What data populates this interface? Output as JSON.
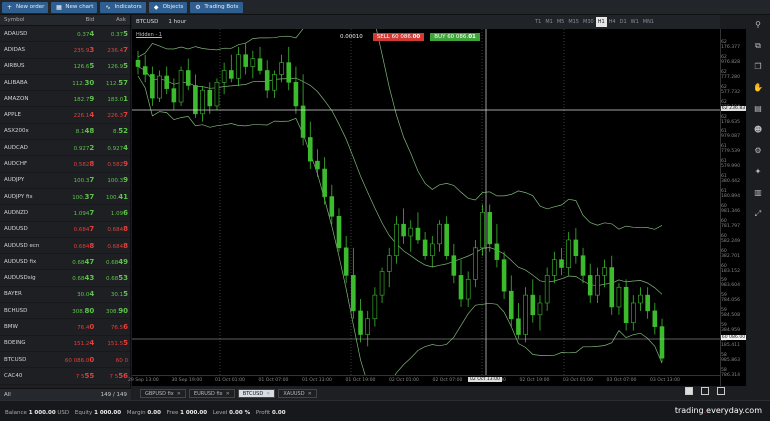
{
  "toolbar": {
    "buttons": [
      {
        "label": "New order",
        "icon": "plus-icon"
      },
      {
        "label": "New chart",
        "icon": "chart-icon"
      },
      {
        "label": "Indicators",
        "icon": "indicators-icon"
      },
      {
        "label": "Objects",
        "icon": "objects-icon"
      },
      {
        "label": "Trading Bots",
        "icon": "bot-icon"
      }
    ]
  },
  "watchlist": {
    "headers": {
      "symbol": "Symbol",
      "bid": "Bid",
      "ask": "Ask"
    },
    "rows": [
      {
        "symbol": "ADAUSD",
        "bid": "0.37",
        "bid_big": "4",
        "ask": "0.37",
        "ask_big": "5",
        "dir": "up"
      },
      {
        "symbol": "ADIDAS",
        "bid": "235.9",
        "bid_big": "3",
        "ask": "236.4",
        "ask_big": "7",
        "dir": "down"
      },
      {
        "symbol": "AIRBUS",
        "bid": "126.6",
        "bid_big": "5",
        "ask": "126.9",
        "ask_big": "5",
        "dir": "up"
      },
      {
        "symbol": "ALIBABA",
        "bid": "112.",
        "bid_big": "30",
        "ask": "112.",
        "ask_big": "57",
        "dir": "up"
      },
      {
        "symbol": "AMAZON",
        "bid": "182.7",
        "bid_big": "9",
        "ask": "183.0",
        "ask_big": "1",
        "dir": "up"
      },
      {
        "symbol": "APPLE",
        "bid": "226.1",
        "bid_big": "4",
        "ask": "226.3",
        "ask_big": "7",
        "dir": "down"
      },
      {
        "symbol": "ASX200x",
        "bid": "8.1",
        "bid_big": "48",
        "ask": "8.",
        "ask_big": "52",
        "dir": "up"
      },
      {
        "symbol": "AUDCAD",
        "bid": "0.927",
        "bid_big": "2",
        "ask": "0.927",
        "ask_big": "4",
        "dir": "up"
      },
      {
        "symbol": "AUDCHF",
        "bid": "0.582",
        "bid_big": "8",
        "ask": "0.582",
        "ask_big": "9",
        "dir": "down"
      },
      {
        "symbol": "AUDJPY",
        "bid": "100.3",
        "bid_big": "7",
        "ask": "100.3",
        "ask_big": "9",
        "dir": "up"
      },
      {
        "symbol": "AUDJPY fix",
        "bid": "100.",
        "bid_big": "37",
        "ask": "100.",
        "ask_big": "41",
        "dir": "up"
      },
      {
        "symbol": "AUDNZD",
        "bid": "1.094",
        "bid_big": "7",
        "ask": "1.09",
        "ask_big": "6",
        "dir": "up"
      },
      {
        "symbol": "AUDUSD",
        "bid": "0.684",
        "bid_big": "7",
        "ask": "0.684",
        "ask_big": "8",
        "dir": "down"
      },
      {
        "symbol": "AUDUSD ecn",
        "bid": "0.684",
        "bid_big": "8",
        "ask": "0.684",
        "ask_big": "8",
        "dir": "down"
      },
      {
        "symbol": "AUDUSD fix",
        "bid": "0.68",
        "bid_big": "47",
        "ask": "0.68",
        "ask_big": "49",
        "dir": "up"
      },
      {
        "symbol": "AUDUSDsig",
        "bid": "0.68",
        "bid_big": "43",
        "ask": "0.68",
        "ask_big": "53",
        "dir": "up"
      },
      {
        "symbol": "BAYER",
        "bid": "30.0",
        "bid_big": "4",
        "ask": "30.1",
        "ask_big": "5",
        "dir": "up"
      },
      {
        "symbol": "BCHUSD",
        "bid": "308.",
        "bid_big": "80",
        "ask": "308.",
        "ask_big": "90",
        "dir": "up"
      },
      {
        "symbol": "BMW",
        "bid": "76.4",
        "bid_big": "0",
        "ask": "76.5",
        "ask_big": "6",
        "dir": "down"
      },
      {
        "symbol": "BOEING",
        "bid": "151.2",
        "bid_big": "4",
        "ask": "151.5",
        "ask_big": "5",
        "dir": "down"
      },
      {
        "symbol": "BTCUSD",
        "bid": "60 086.0",
        "bid_big": "0",
        "ask": "60 0",
        "ask_big": "",
        "dir": "down"
      },
      {
        "symbol": "CAC40",
        "bid": "7 5",
        "bid_big": "55",
        "ask": "7 5",
        "ask_big": "56",
        "dir": "down"
      }
    ],
    "footer": {
      "filter": "All",
      "count": "149 / 149"
    }
  },
  "chart": {
    "symbol": "BTCUSD",
    "timeframe": "1 hour",
    "timeframes": [
      "T1",
      "M1",
      "M5",
      "M15",
      "M30",
      "H1",
      "H4",
      "D1",
      "W1",
      "MN1"
    ],
    "active_timeframe": "H1",
    "indicator_label": "Hidden - 1",
    "trade": {
      "quantity": "0.00010",
      "sell_label": "SELL",
      "sell_price": "60 086.",
      "sell_big": "00",
      "buy_label": "BUY",
      "buy_price": "60 086.",
      "buy_big": "01"
    },
    "y_ticks": [
      "62 176.377",
      "62 976.828",
      "62 777.280",
      "62 577.732",
      "62 378.184",
      "62 178.635",
      "61 979.087",
      "61 779.539",
      "61 579.990",
      "61 380.442",
      "61 180.894",
      "60 981.346",
      "60 781.797",
      "60 582.249",
      "60 382.701",
      "60 183.152",
      "59 983.604",
      "59 784.056",
      "59 584.508",
      "59 384.959",
      "59 185.411",
      "58 985.863",
      "58 786.314"
    ],
    "crosshair_price": "62 236.83",
    "current_price": "60 086.00",
    "x_ticks": [
      "29 Sep 13:00",
      "30 Sep 19:00",
      "01 Oct 01:00",
      "01 Oct 07:00",
      "01 Oct 13:00",
      "01 Oct 19:00",
      "02 Oct 01:00",
      "02 Oct 07:00",
      "02 Oct 13:00",
      "02 Oct 19:00",
      "03 Oct 01:00",
      "03 Oct 07:00",
      "03 Oct 13:00"
    ],
    "crosshair_time": "02 Oct 13:00",
    "tabs": [
      {
        "label": "GBPUSD fix",
        "active": false
      },
      {
        "label": "EURUSD fix",
        "active": false
      },
      {
        "label": "BTCUSD",
        "active": true
      },
      {
        "label": "XAUUSD",
        "active": false
      }
    ]
  },
  "chart_data": {
    "type": "candlestick",
    "symbol": "BTCUSD",
    "timeframe": "H1",
    "ylim": [
      58786.314,
      63176.377
    ],
    "candle_color": "#3dbb2e",
    "candles": [
      {
        "o": 62780,
        "h": 62900,
        "l": 62600,
        "c": 62700
      },
      {
        "o": 62700,
        "h": 62850,
        "l": 62500,
        "c": 62600
      },
      {
        "o": 62600,
        "h": 62700,
        "l": 62200,
        "c": 62300
      },
      {
        "o": 62300,
        "h": 62650,
        "l": 62250,
        "c": 62580
      },
      {
        "o": 62580,
        "h": 62700,
        "l": 62350,
        "c": 62420
      },
      {
        "o": 62420,
        "h": 62550,
        "l": 62150,
        "c": 62250
      },
      {
        "o": 62250,
        "h": 62700,
        "l": 62200,
        "c": 62650
      },
      {
        "o": 62650,
        "h": 62800,
        "l": 62400,
        "c": 62460
      },
      {
        "o": 62460,
        "h": 62600,
        "l": 62050,
        "c": 62100
      },
      {
        "o": 62100,
        "h": 62450,
        "l": 62000,
        "c": 62400
      },
      {
        "o": 62400,
        "h": 62500,
        "l": 62100,
        "c": 62200
      },
      {
        "o": 62200,
        "h": 62550,
        "l": 62150,
        "c": 62500
      },
      {
        "o": 62500,
        "h": 62750,
        "l": 62350,
        "c": 62650
      },
      {
        "o": 62650,
        "h": 62850,
        "l": 62500,
        "c": 62550
      },
      {
        "o": 62550,
        "h": 62950,
        "l": 62450,
        "c": 62850
      },
      {
        "o": 62850,
        "h": 63000,
        "l": 62600,
        "c": 62700
      },
      {
        "o": 62700,
        "h": 62900,
        "l": 62550,
        "c": 62800
      },
      {
        "o": 62800,
        "h": 62950,
        "l": 62600,
        "c": 62650
      },
      {
        "o": 62650,
        "h": 62780,
        "l": 62300,
        "c": 62400
      },
      {
        "o": 62400,
        "h": 62650,
        "l": 62300,
        "c": 62600
      },
      {
        "o": 62600,
        "h": 62850,
        "l": 62500,
        "c": 62750
      },
      {
        "o": 62750,
        "h": 62950,
        "l": 62400,
        "c": 62500
      },
      {
        "o": 62500,
        "h": 62700,
        "l": 62100,
        "c": 62200
      },
      {
        "o": 62200,
        "h": 62600,
        "l": 61700,
        "c": 61800
      },
      {
        "o": 61800,
        "h": 62000,
        "l": 61400,
        "c": 61500
      },
      {
        "o": 61500,
        "h": 61650,
        "l": 61300,
        "c": 61400
      },
      {
        "o": 61400,
        "h": 61550,
        "l": 60950,
        "c": 61050
      },
      {
        "o": 61050,
        "h": 61200,
        "l": 60700,
        "c": 60800
      },
      {
        "o": 60800,
        "h": 60900,
        "l": 60350,
        "c": 60400
      },
      {
        "o": 60400,
        "h": 60550,
        "l": 59950,
        "c": 60050
      },
      {
        "o": 60050,
        "h": 60400,
        "l": 59500,
        "c": 59600
      },
      {
        "o": 59600,
        "h": 59750,
        "l": 59200,
        "c": 59300
      },
      {
        "o": 59300,
        "h": 59600,
        "l": 59150,
        "c": 59500
      },
      {
        "o": 59500,
        "h": 59900,
        "l": 59400,
        "c": 59800
      },
      {
        "o": 59800,
        "h": 60150,
        "l": 59700,
        "c": 60100
      },
      {
        "o": 60100,
        "h": 60400,
        "l": 59900,
        "c": 60300
      },
      {
        "o": 60300,
        "h": 60800,
        "l": 60200,
        "c": 60700
      },
      {
        "o": 60700,
        "h": 60900,
        "l": 60450,
        "c": 60550
      },
      {
        "o": 60550,
        "h": 60750,
        "l": 60350,
        "c": 60650
      },
      {
        "o": 60650,
        "h": 60850,
        "l": 60450,
        "c": 60500
      },
      {
        "o": 60500,
        "h": 60600,
        "l": 60250,
        "c": 60300
      },
      {
        "o": 60300,
        "h": 60550,
        "l": 60150,
        "c": 60450
      },
      {
        "o": 60450,
        "h": 60750,
        "l": 60350,
        "c": 60700
      },
      {
        "o": 60700,
        "h": 60800,
        "l": 60250,
        "c": 60300
      },
      {
        "o": 60300,
        "h": 60450,
        "l": 59950,
        "c": 60050
      },
      {
        "o": 60050,
        "h": 60250,
        "l": 59650,
        "c": 59750
      },
      {
        "o": 59750,
        "h": 60100,
        "l": 59650,
        "c": 60000
      },
      {
        "o": 60000,
        "h": 60500,
        "l": 59900,
        "c": 60400
      },
      {
        "o": 60400,
        "h": 60950,
        "l": 60300,
        "c": 60850
      },
      {
        "o": 60850,
        "h": 60950,
        "l": 60350,
        "c": 60450
      },
      {
        "o": 60450,
        "h": 60700,
        "l": 60150,
        "c": 60250
      },
      {
        "o": 60250,
        "h": 60350,
        "l": 59750,
        "c": 59850
      },
      {
        "o": 59850,
        "h": 60050,
        "l": 59400,
        "c": 59500
      },
      {
        "o": 59500,
        "h": 59700,
        "l": 59250,
        "c": 59300
      },
      {
        "o": 59300,
        "h": 59900,
        "l": 59200,
        "c": 59800
      },
      {
        "o": 59800,
        "h": 60000,
        "l": 59450,
        "c": 59550
      },
      {
        "o": 59550,
        "h": 59800,
        "l": 59350,
        "c": 59700
      },
      {
        "o": 59700,
        "h": 60150,
        "l": 59600,
        "c": 60050
      },
      {
        "o": 60050,
        "h": 60350,
        "l": 59950,
        "c": 60250
      },
      {
        "o": 60250,
        "h": 60400,
        "l": 60050,
        "c": 60150
      },
      {
        "o": 60150,
        "h": 60600,
        "l": 60050,
        "c": 60500
      },
      {
        "o": 60500,
        "h": 60650,
        "l": 60200,
        "c": 60300
      },
      {
        "o": 60300,
        "h": 60400,
        "l": 59950,
        "c": 60050
      },
      {
        "o": 60050,
        "h": 60200,
        "l": 59700,
        "c": 59800
      },
      {
        "o": 59800,
        "h": 60150,
        "l": 59700,
        "c": 60050
      },
      {
        "o": 60050,
        "h": 60250,
        "l": 59900,
        "c": 60150
      },
      {
        "o": 60150,
        "h": 60300,
        "l": 59550,
        "c": 59650
      },
      {
        "o": 59650,
        "h": 59950,
        "l": 59550,
        "c": 59900
      },
      {
        "o": 59900,
        "h": 60000,
        "l": 59350,
        "c": 59450
      },
      {
        "o": 59450,
        "h": 59800,
        "l": 59350,
        "c": 59700
      },
      {
        "o": 59700,
        "h": 59900,
        "l": 59600,
        "c": 59800
      },
      {
        "o": 59800,
        "h": 59900,
        "l": 59500,
        "c": 59600
      },
      {
        "o": 59600,
        "h": 59700,
        "l": 59300,
        "c": 59400
      },
      {
        "o": 59400,
        "h": 59500,
        "l": 58950,
        "c": 59000
      }
    ]
  },
  "sidebar_icons": [
    "pin-icon",
    "layers-icon",
    "copy-icon",
    "hand-icon",
    "cards-icon",
    "person-icon",
    "settings-icon",
    "gear-icon",
    "chart-bars-icon",
    "expand-icon"
  ],
  "status": {
    "balance_label": "Balance",
    "balance": "1 000.00",
    "currency": "USD",
    "equity_label": "Equity",
    "equity": "1 000.00",
    "margin_label": "Margin",
    "margin": "0.00",
    "free_label": "Free",
    "free": "1 000.00",
    "level_label": "Level",
    "level": "0.00 %",
    "profit_label": "Profit",
    "profit": "0.00"
  },
  "brand": {
    "part1": "trading",
    "part2": "everyday",
    "part3": ".com"
  }
}
